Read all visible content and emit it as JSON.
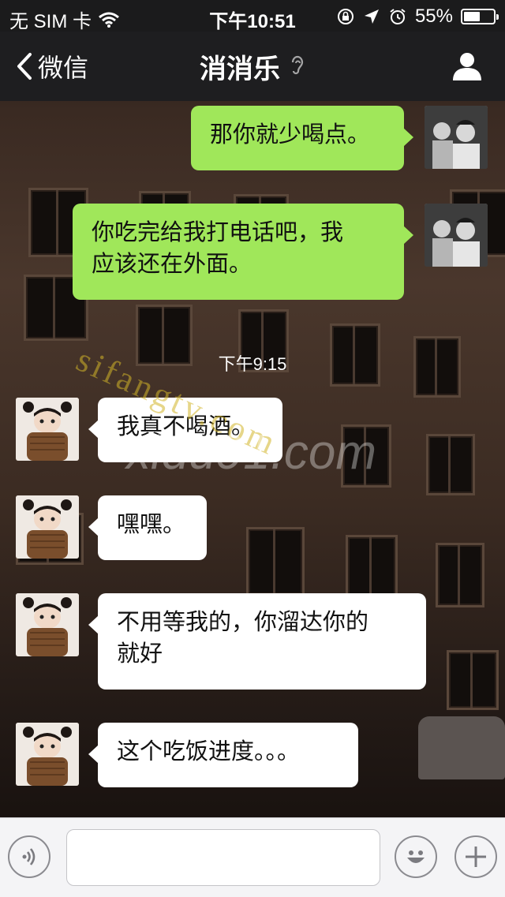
{
  "status_bar": {
    "carrier": "无 SIM 卡",
    "time": "下午10:51",
    "battery": "55%",
    "battery_level": 0.55
  },
  "nav": {
    "back_label": "微信",
    "title": "消消乐"
  },
  "chat": {
    "timestamp": "下午9:15",
    "messages": [
      {
        "side": "sent",
        "lines": [
          "那你就少喝点。"
        ]
      },
      {
        "side": "sent",
        "lines": [
          "你吃完给我打电话吧，我",
          "应该还在外面。"
        ]
      },
      {
        "side": "received",
        "lines": [
          "我真不喝酒。"
        ]
      },
      {
        "side": "received",
        "lines": [
          "嘿嘿。"
        ]
      },
      {
        "side": "received",
        "lines": [
          "不用等我的，你溜达你的",
          "就好"
        ]
      },
      {
        "side": "received",
        "lines": [
          "这个吃饭进度。。。"
        ]
      }
    ]
  },
  "watermarks": {
    "first": "sifangtv.com",
    "second": "xidu91.com"
  },
  "input": {
    "value": "",
    "placeholder": ""
  },
  "icons": {
    "voice": "voice-icon",
    "emoji": "emoji-icon",
    "plus": "plus-icon",
    "profile": "person-icon",
    "ear": "ear-icon"
  }
}
